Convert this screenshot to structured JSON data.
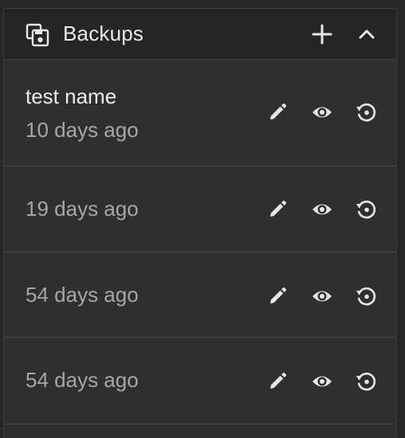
{
  "panel": {
    "title": "Backups",
    "icon": "backup-icon",
    "add_icon": "plus-icon",
    "collapse_icon": "chevron-up-icon"
  },
  "backups": [
    {
      "name": "test name",
      "time": "10 days ago"
    },
    {
      "name": "",
      "time": "19 days ago"
    },
    {
      "name": "",
      "time": "54 days ago"
    },
    {
      "name": "",
      "time": "54 days ago"
    }
  ],
  "row_icons": [
    "pencil-icon",
    "eye-icon",
    "restore-icon"
  ],
  "colors": {
    "background": "#272727",
    "panel": "#2f2f2f",
    "header": "#252525",
    "text_primary": "#ececec",
    "text_secondary": "#a6a6a6",
    "icon": "#e6e6e6"
  }
}
